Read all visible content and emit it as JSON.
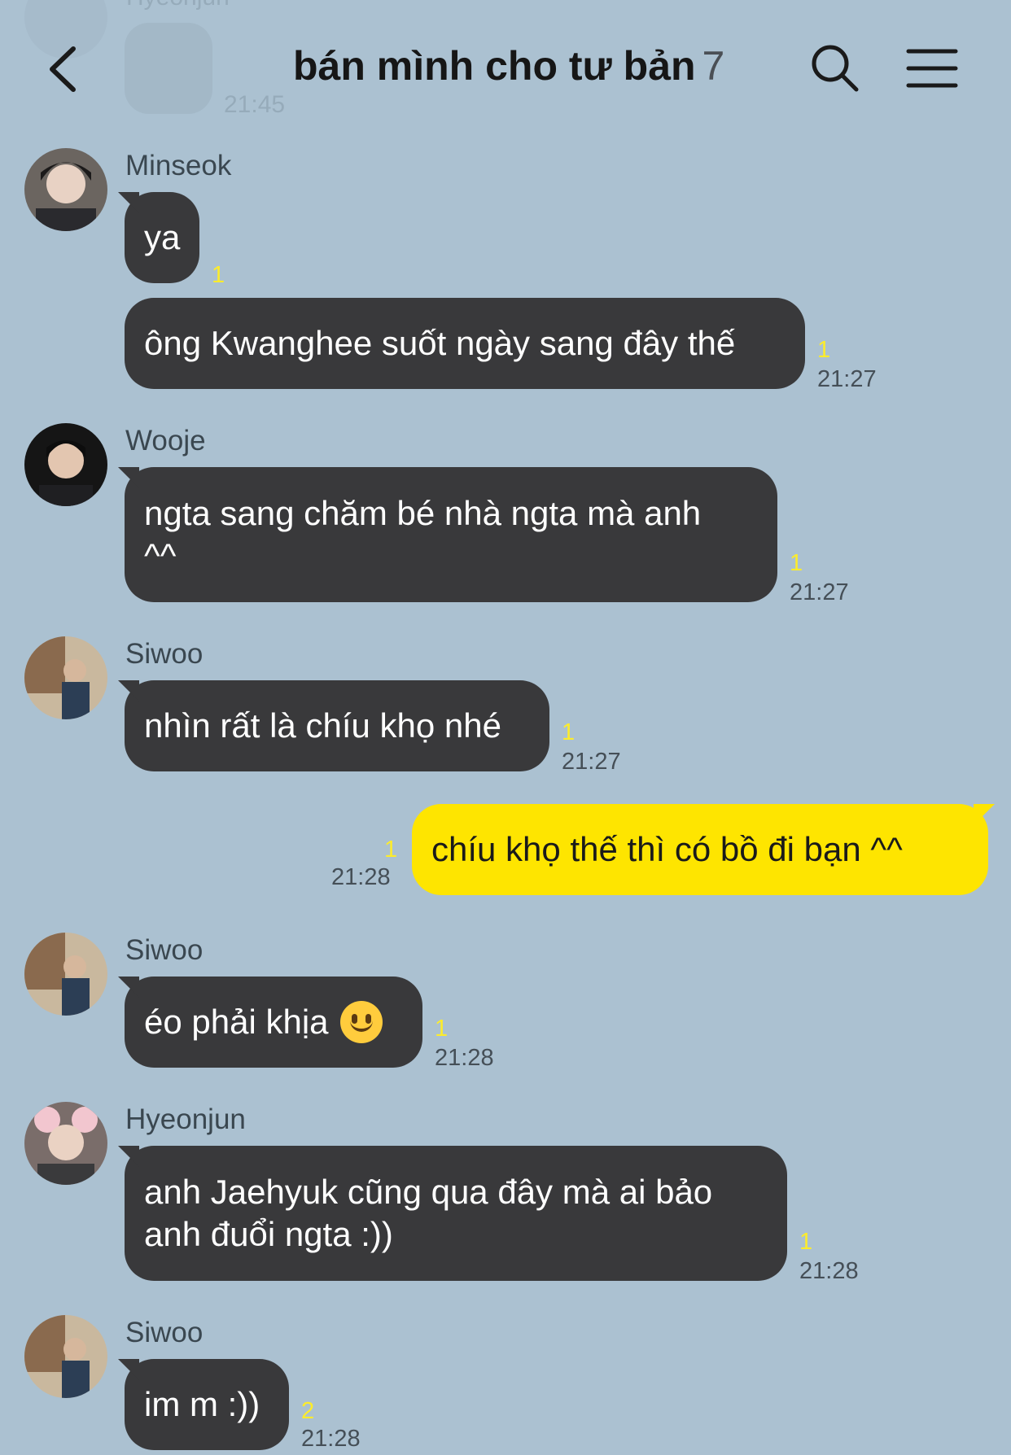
{
  "header": {
    "title": "bán mình cho tư bản",
    "member_count": "7",
    "faded_sender": "Hyeonjun",
    "faded_time": "21:45"
  },
  "colors": {
    "background": "#abc1d1",
    "other_bubble": "#39393b",
    "my_bubble": "#fee500",
    "unread": "#fcec2c"
  },
  "icons": {
    "back": "chevron-left-icon",
    "search": "search-icon",
    "menu": "hamburger-menu-icon",
    "emoji": "slightly-smiling-face-emoji"
  },
  "messages": [
    {
      "sender": "Minseok",
      "text": "ya",
      "unread": "1",
      "time": ""
    },
    {
      "sender": "",
      "text": "ông Kwanghee suốt ngày sang đây thế",
      "unread": "1",
      "time": "21:27"
    },
    {
      "sender": "Wooje",
      "text": "ngta sang chăm bé nhà ngta mà anh ^^",
      "unread": "1",
      "time": "21:27"
    },
    {
      "sender": "Siwoo",
      "text": "nhìn rất là chíu khọ nhé",
      "unread": "1",
      "time": "21:27"
    },
    {
      "sender": "me",
      "text": "chíu khọ thế thì có bồ đi bạn ^^",
      "unread": "1",
      "time": "21:28"
    },
    {
      "sender": "Siwoo",
      "text": "éo phải khịa",
      "unread": "1",
      "time": "21:28"
    },
    {
      "sender": "Hyeonjun",
      "text": "anh Jaehyuk cũng qua đây mà ai bảo anh đuổi ngta :))",
      "unread": "1",
      "time": "21:28"
    },
    {
      "sender": "Siwoo",
      "text": "im m :))",
      "unread": "2",
      "time": "21:28"
    }
  ]
}
